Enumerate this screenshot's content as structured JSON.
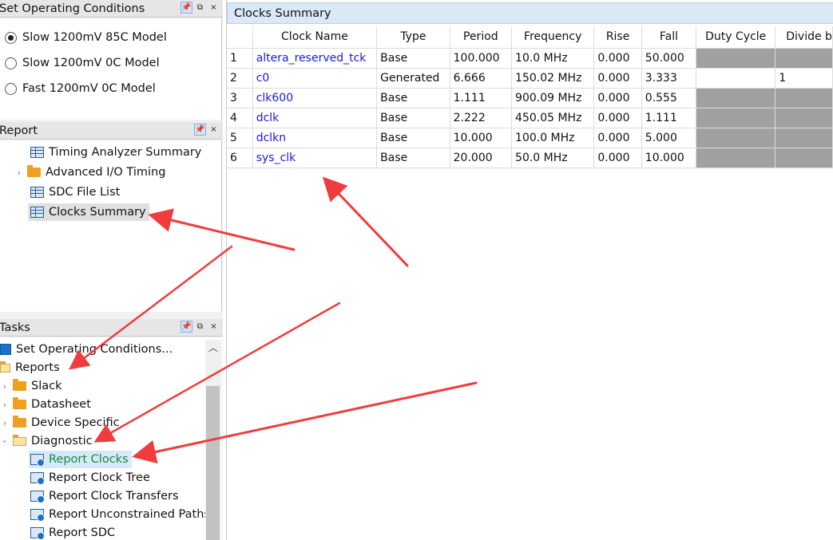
{
  "operating_conditions": {
    "title": "Set Operating Conditions",
    "options": [
      {
        "label": "Slow 1200mV 85C Model",
        "selected": true
      },
      {
        "label": "Slow 1200mV 0C Model",
        "selected": false
      },
      {
        "label": "Fast 1200mV 0C Model",
        "selected": false
      }
    ]
  },
  "report_panel": {
    "title": "Report",
    "items": [
      {
        "label": "Timing Analyzer Summary",
        "icon": "table-icon"
      },
      {
        "label": "Advanced I/O Timing",
        "icon": "folder-icon"
      },
      {
        "label": "SDC File List",
        "icon": "table-icon"
      },
      {
        "label": "Clocks Summary",
        "icon": "table-icon",
        "selected": true
      }
    ]
  },
  "tasks_panel": {
    "title": "Tasks",
    "items": [
      {
        "label": "Set Operating Conditions...",
        "icon": "blue-square-icon"
      },
      {
        "label": "Reports",
        "icon": "folder-open-icon"
      },
      {
        "label": "Slack",
        "icon": "folder-icon"
      },
      {
        "label": "Datasheet",
        "icon": "folder-icon"
      },
      {
        "label": "Device Specific",
        "icon": "folder-icon"
      },
      {
        "label": "Diagnostic",
        "icon": "folder-open-icon"
      },
      {
        "label": "Report Clocks",
        "icon": "task-icon",
        "selected": true
      },
      {
        "label": "Report Clock Tree",
        "icon": "task-icon"
      },
      {
        "label": "Report Clock Transfers",
        "icon": "task-icon"
      },
      {
        "label": "Report Unconstrained Paths",
        "icon": "task-icon"
      },
      {
        "label": "Report SDC",
        "icon": "task-icon"
      }
    ]
  },
  "panel_controls": {
    "pin": "📌",
    "float": "⧉",
    "close": "×"
  },
  "clocks_summary": {
    "title": "Clocks Summary",
    "columns": [
      "",
      "Clock Name",
      "Type",
      "Period",
      "Frequency",
      "Rise",
      "Fall",
      "Duty Cycle",
      "Divide b"
    ],
    "rows": [
      {
        "idx": "1",
        "name": "altera_reserved_tck",
        "type": "Base",
        "period": "100.000",
        "freq": "10.0 MHz",
        "rise": "0.000",
        "fall": "50.000",
        "duty": "",
        "divide": ""
      },
      {
        "idx": "2",
        "name": "c0",
        "type": "Generated",
        "period": "6.666",
        "freq": "150.02 MHz",
        "rise": "0.000",
        "fall": "3.333",
        "duty": "",
        "divide": "1"
      },
      {
        "idx": "3",
        "name": "clk600",
        "type": "Base",
        "period": "1.111",
        "freq": "900.09 MHz",
        "rise": "0.000",
        "fall": "0.555",
        "duty": "",
        "divide": ""
      },
      {
        "idx": "4",
        "name": "dclk",
        "type": "Base",
        "period": "2.222",
        "freq": "450.05 MHz",
        "rise": "0.000",
        "fall": "1.111",
        "duty": "",
        "divide": ""
      },
      {
        "idx": "5",
        "name": "dclkn",
        "type": "Base",
        "period": "10.000",
        "freq": "100.0 MHz",
        "rise": "0.000",
        "fall": "5.000",
        "duty": "",
        "divide": ""
      },
      {
        "idx": "6",
        "name": "sys_clk",
        "type": "Base",
        "period": "20.000",
        "freq": "50.0 MHz",
        "rise": "0.000",
        "fall": "10.000",
        "duty": "",
        "divide": ""
      }
    ]
  },
  "colors": {
    "annotation_arrow": "#f03c3c",
    "link": "#1b1bd8",
    "selected_task": "#178a3a"
  }
}
